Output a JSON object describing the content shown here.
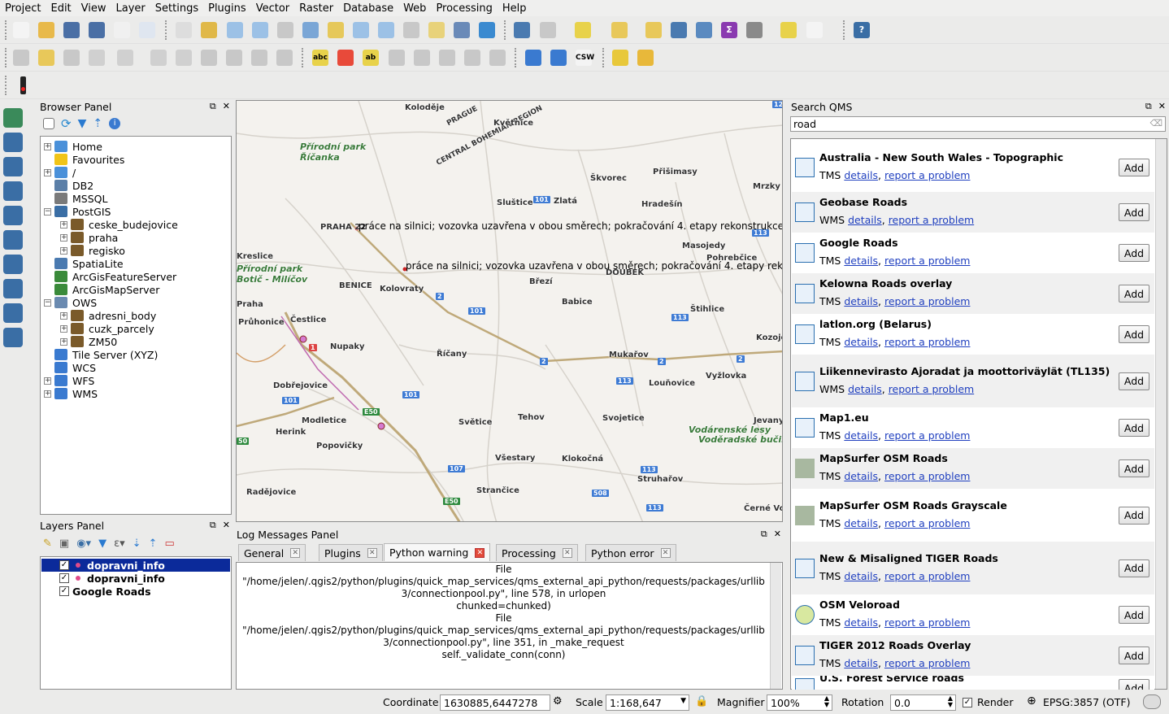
{
  "menu": [
    "Project",
    "Edit",
    "View",
    "Layer",
    "Settings",
    "Plugins",
    "Vector",
    "Raster",
    "Database",
    "Web",
    "Processing",
    "Help"
  ],
  "browser": {
    "title": "Browser Panel",
    "items": [
      {
        "label": "Home",
        "indent": 0,
        "exp": "+",
        "color": "#4a90d9"
      },
      {
        "label": "Favourites",
        "indent": 0,
        "exp": "",
        "color": "#f0c419"
      },
      {
        "label": "/",
        "indent": 0,
        "exp": "+",
        "color": "#4a90d9"
      },
      {
        "label": "DB2",
        "indent": 0,
        "exp": "",
        "color": "#5b7fa8"
      },
      {
        "label": "MSSQL",
        "indent": 0,
        "exp": "",
        "color": "#7a7a7a"
      },
      {
        "label": "PostGIS",
        "indent": 0,
        "exp": "-",
        "color": "#3a6ea5"
      },
      {
        "label": "ceske_budejovice",
        "indent": 1,
        "exp": "+",
        "color": "#7a5a2a"
      },
      {
        "label": "praha",
        "indent": 1,
        "exp": "+",
        "color": "#7a5a2a"
      },
      {
        "label": "regisko",
        "indent": 1,
        "exp": "+",
        "color": "#7a5a2a"
      },
      {
        "label": "SpatiaLite",
        "indent": 0,
        "exp": "",
        "color": "#4a7ab0"
      },
      {
        "label": "ArcGisFeatureServer",
        "indent": 0,
        "exp": "",
        "color": "#3a8a3a"
      },
      {
        "label": "ArcGisMapServer",
        "indent": 0,
        "exp": "",
        "color": "#3a8a3a"
      },
      {
        "label": "OWS",
        "indent": 0,
        "exp": "-",
        "color": "#6a8ab0"
      },
      {
        "label": "adresni_body",
        "indent": 1,
        "exp": "+",
        "color": "#7a5a2a"
      },
      {
        "label": "cuzk_parcely",
        "indent": 1,
        "exp": "+",
        "color": "#7a5a2a"
      },
      {
        "label": "ZM50",
        "indent": 1,
        "exp": "+",
        "color": "#7a5a2a"
      },
      {
        "label": "Tile Server (XYZ)",
        "indent": 0,
        "exp": "",
        "color": "#3a7ad0"
      },
      {
        "label": "WCS",
        "indent": 0,
        "exp": "",
        "color": "#3a7ad0"
      },
      {
        "label": "WFS",
        "indent": 0,
        "exp": "+",
        "color": "#3a7ad0"
      },
      {
        "label": "WMS",
        "indent": 0,
        "exp": "+",
        "color": "#3a7ad0"
      }
    ]
  },
  "layers": {
    "title": "Layers Panel",
    "items": [
      {
        "label": "dopravni_info",
        "selected": true,
        "dot": true
      },
      {
        "label": "dopravni_info",
        "selected": false,
        "dot": true
      },
      {
        "label": "Google Roads",
        "selected": false,
        "dot": false
      }
    ]
  },
  "map": {
    "places": [
      "Koloděje",
      "PRAGUE",
      "CENTRAL BOHEMIAN REGION",
      "Květnice",
      "Přírodní park Říčanka",
      "Škvorec",
      "Přišimasy",
      "Mrzky",
      "Sluštice",
      "Zlatá",
      "Hradešín",
      "PRAHA 22",
      "Kreslice",
      "Masojedy",
      "Pohrebčice",
      "Kolovraty",
      "Březí",
      "Babice",
      "DOUBEK",
      "Přírodní park Botič - Milíčov",
      "BENICE",
      "Praha",
      "Průhonice",
      "Čestlice",
      "Nupaky",
      "Říčany",
      "Mukařov",
      "Štihlice",
      "Kozojedy",
      "Dobřejovice",
      "Louňovice",
      "Vyžlovka",
      "Modletice",
      "Herink",
      "Popovičky",
      "Světice",
      "Tehov",
      "Svojetice",
      "Jevany",
      "Vodárenské lesy",
      "Voděradské bučiny",
      "Všestary",
      "Klokočná",
      "Struhařov",
      "Radějovice",
      "Strančice",
      "Černé Voděrady"
    ],
    "annotation1": "práce na silnici; vozovka uzavřena v obou směrech; pokračování 4. etapy rekonstrukce",
    "annotation2": "práce na silnici; vozovka uzavřena v obou směrech; pokračování 4. etapy rek"
  },
  "log": {
    "title": "Log Messages Panel",
    "tabs": [
      "General",
      "Plugins",
      "Python warning",
      "Processing",
      "Python error"
    ],
    "active": "Python warning",
    "text": "File\n\"/home/jelen/.qgis2/python/plugins/quick_map_services/qms_external_api_python/requests/packages/urllib3/connectionpool.py\", line 578, in urlopen\nchunked=chunked)\nFile\n\"/home/jelen/.qgis2/python/plugins/quick_map_services/qms_external_api_python/requests/packages/urllib3/connectionpool.py\", line 351, in _make_request\nself._validate_conn(conn)"
  },
  "qms": {
    "title": "Search QMS",
    "query": "road",
    "add_label": "Add",
    "details": "details",
    "report": "report a problem",
    "items": [
      {
        "name": "Australia - New South Wales - Topographic",
        "type": "TMS"
      },
      {
        "name": "Geobase Roads",
        "type": "WMS"
      },
      {
        "name": "Google Roads",
        "type": "TMS"
      },
      {
        "name": "Kelowna Roads overlay",
        "type": "TMS"
      },
      {
        "name": "latlon.org (Belarus)",
        "type": "TMS"
      },
      {
        "name": "Liikennevirasto Ajoradat ja moottoriväylät (TL135)",
        "type": "WMS"
      },
      {
        "name": "Map1.eu",
        "type": "TMS"
      },
      {
        "name": "MapSurfer OSM Roads",
        "type": "TMS"
      },
      {
        "name": "MapSurfer OSM Roads Grayscale",
        "type": "TMS"
      },
      {
        "name": "New & Misaligned TIGER Roads",
        "type": "TMS"
      },
      {
        "name": "OSM Veloroad",
        "type": "TMS"
      },
      {
        "name": "TIGER 2012 Roads Overlay",
        "type": "TMS"
      },
      {
        "name": "U.S. Forest Service roads",
        "type": "TMS"
      }
    ]
  },
  "status": {
    "coordinate_label": "Coordinate",
    "coordinate": "1630885,6447278",
    "scale_label": "Scale",
    "scale": "1:168,647",
    "magnifier_label": "Magnifier",
    "magnifier": "100%",
    "rotation_label": "Rotation",
    "rotation": "0.0",
    "render_label": "Render",
    "crs": "EPSG:3857 (OTF)"
  }
}
